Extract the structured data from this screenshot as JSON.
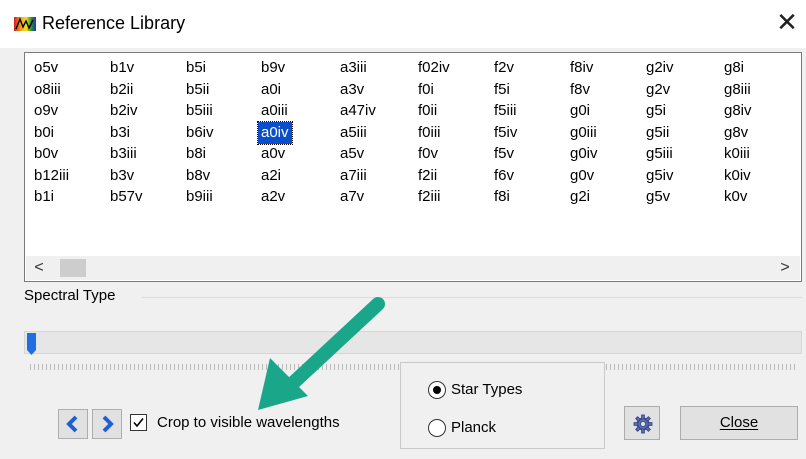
{
  "window": {
    "title": "Reference Library",
    "close_symbol": "✕"
  },
  "reference_list": {
    "columns": [
      [
        "o5v",
        "o8iii",
        "o9v",
        "b0i",
        "b0v",
        "b12iii",
        "b1i"
      ],
      [
        "b1v",
        "b2ii",
        "b2iv",
        "b3i",
        "b3iii",
        "b3v",
        "b57v"
      ],
      [
        "b5i",
        "b5ii",
        "b5iii",
        "b6iv",
        "b8i",
        "b8v",
        "b9iii"
      ],
      [
        "b9v",
        "a0i",
        "a0iii",
        "a0iv",
        "a0v",
        "a2i",
        "a2v"
      ],
      [
        "a3iii",
        "a3v",
        "a47iv",
        "a5iii",
        "a5v",
        "a7iii",
        "a7v"
      ],
      [
        "f02iv",
        "f0i",
        "f0ii",
        "f0iii",
        "f0v",
        "f2ii",
        "f2iii"
      ],
      [
        "f2v",
        "f5i",
        "f5iii",
        "f5iv",
        "f5v",
        "f6v",
        "f8i"
      ],
      [
        "f8iv",
        "f8v",
        "g0i",
        "g0iii",
        "g0iv",
        "g0v",
        "g2i"
      ],
      [
        "g2iv",
        "g2v",
        "g5i",
        "g5ii",
        "g5iii",
        "g5iv",
        "g5v"
      ],
      [
        "g8i",
        "g8iii",
        "g8iv",
        "g8v",
        "k0iii",
        "k0iv",
        "k0v"
      ]
    ],
    "selected": "a0iv",
    "scroll_left": "<",
    "scroll_right": ">"
  },
  "spectral_type": {
    "label": "Spectral Type",
    "slider_value": 0
  },
  "controls": {
    "prev_icon": "chevron-left-icon",
    "next_icon": "chevron-right-icon",
    "crop_label": "Crop to visible wavelengths",
    "crop_checked": true,
    "radio_options": [
      {
        "label": "Star Types",
        "selected": true
      },
      {
        "label": "Planck",
        "selected": false
      }
    ],
    "settings_icon": "gear-icon",
    "close_label": "Close"
  },
  "colors": {
    "selection": "#0a4ec9",
    "nav_arrow": "#1f5fd6",
    "annotation_arrow": "#1aa789",
    "slider_thumb": "#1f6fe0"
  }
}
